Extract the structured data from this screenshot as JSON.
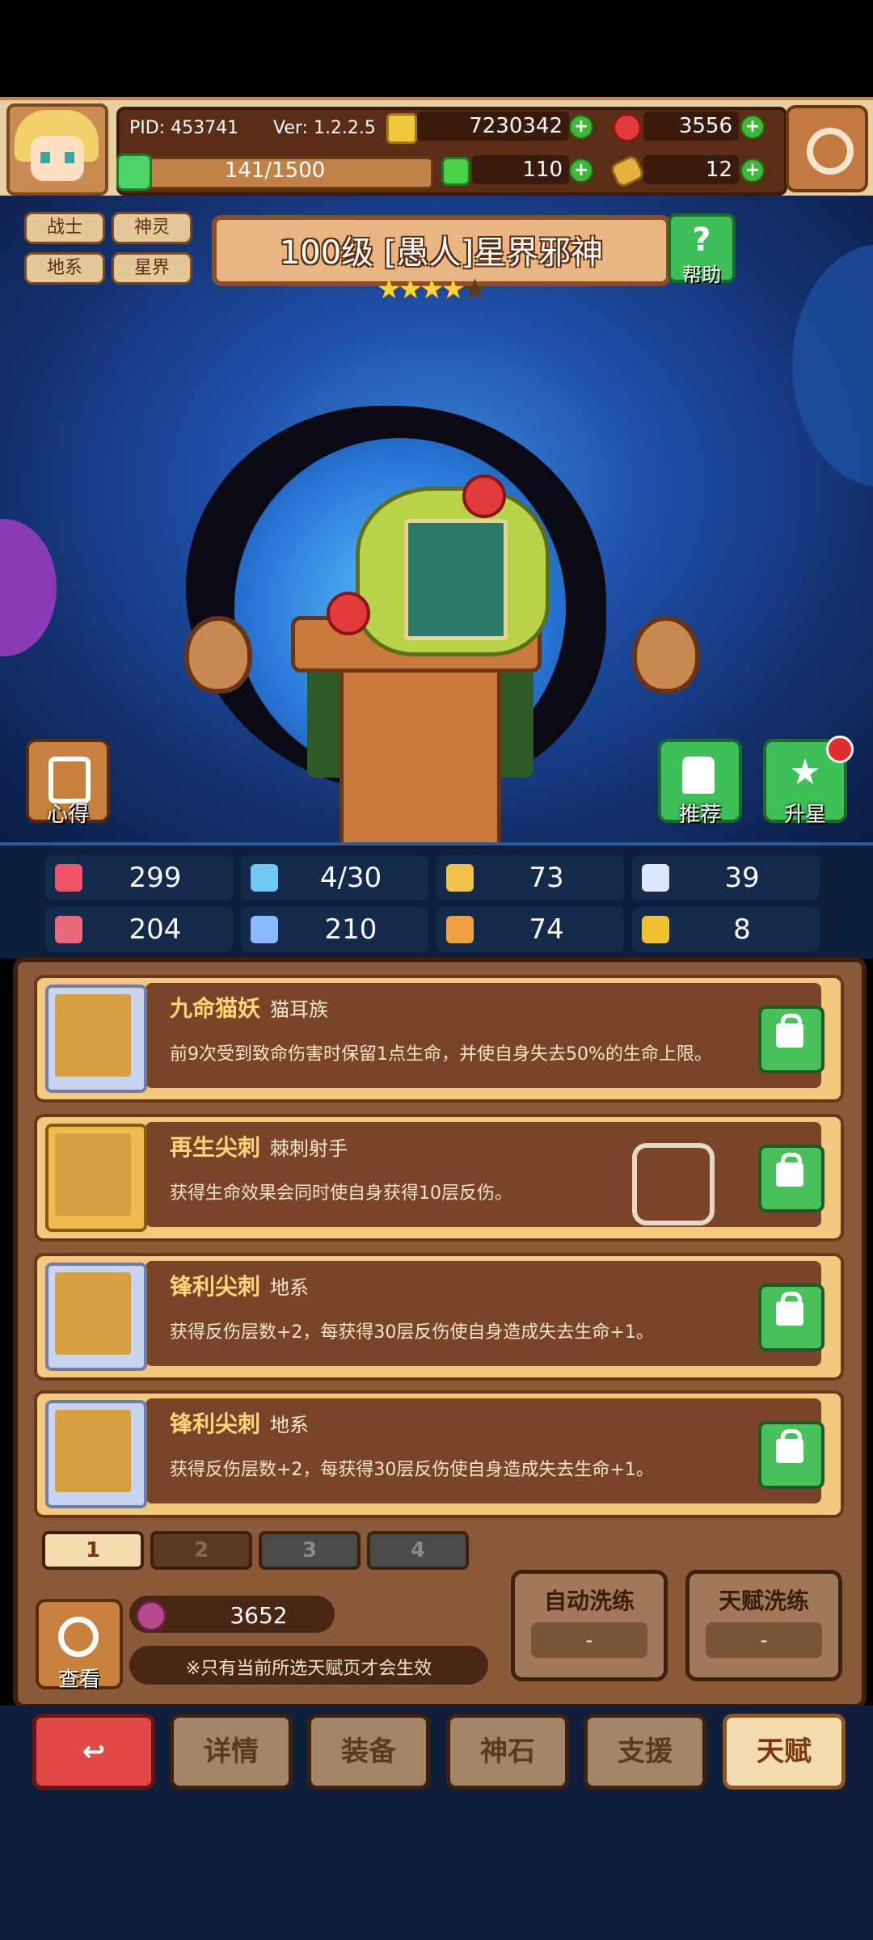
{
  "player": {
    "pid_text": "PID: 453741",
    "version_text": "Ver: 1.2.2.5",
    "gold": "7230342",
    "gems": "3556",
    "stamina": "141/1500",
    "clover": "110",
    "food": "12",
    "plus_symbol": "+"
  },
  "hero": {
    "tags": [
      "战士",
      "神灵",
      "地系",
      "星界"
    ],
    "title": "100级 [愚人]星界邪神",
    "stars_filled": "★★★★",
    "stars_empty": "★",
    "star_rating": 4,
    "star_max": 5,
    "help_symbol": "?",
    "help_label": "帮助",
    "notes_label": "心得",
    "recommend_label": "推荐",
    "upgrade_star_label": "升星"
  },
  "stats": [
    {
      "icon": "heart-icon",
      "value": "299",
      "color": "#f0536a"
    },
    {
      "icon": "water-drop-icon",
      "value": "4/30",
      "color": "#6ec8f5"
    },
    {
      "icon": "shield-icon",
      "value": "73",
      "color": "#f0c048"
    },
    {
      "icon": "wing-icon",
      "value": "39",
      "color": "#dfe6ff"
    },
    {
      "icon": "fist-icon",
      "value": "204",
      "color": "#e86a7a"
    },
    {
      "icon": "spellbook-icon",
      "value": "210",
      "color": "#8ab8ff"
    },
    {
      "icon": "boot-icon",
      "value": "74",
      "color": "#f0a040"
    },
    {
      "icon": "horseshoe-icon",
      "value": "8",
      "color": "#f0c030"
    }
  ],
  "talents": [
    {
      "name": "九命猫妖",
      "sub": "猫耳族",
      "desc": "前9次受到致命伤害时保留1点生命，并使自身失去50%的生命上限。",
      "icon": "cat-face-icon"
    },
    {
      "name": "再生尖刺",
      "sub": "棘刺射手",
      "desc": "获得生命效果会同时使自身获得10层反伤。",
      "icon": "star-badge-icon"
    },
    {
      "name": "锋利尖刺",
      "sub": "地系",
      "desc": "获得反伤层数+2，每获得30层反伤使自身造成失去生命+1。",
      "icon": "crossed-spikes-icon"
    },
    {
      "name": "锋利尖刺",
      "sub": "地系",
      "desc": "获得反伤层数+2，每获得30层反伤使自身造成失去生命+1。",
      "icon": "crossed-spikes-icon"
    }
  ],
  "pages": [
    "1",
    "2",
    "3",
    "4"
  ],
  "active_page": "1",
  "bottom_panel": {
    "view_label": "查看",
    "currency_amount": "3652",
    "notice": "※只有当前所选天赋页才会生效",
    "auto_wash_label": "自动洗练",
    "auto_wash_cost": "-",
    "talent_wash_label": "天赋洗练",
    "talent_wash_cost": "-"
  },
  "nav": {
    "back_symbol": "↩",
    "items": [
      "详情",
      "装备",
      "神石",
      "支援",
      "天赋"
    ],
    "active": "天赋"
  }
}
